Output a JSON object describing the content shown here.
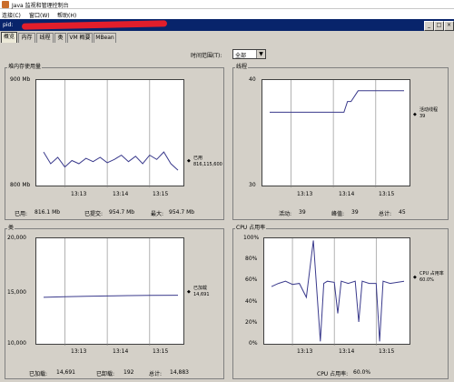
{
  "window": {
    "title": "Java 监视和管理控制台"
  },
  "menu": [
    "连接(C)",
    "窗口(W)",
    "帮助(H)"
  ],
  "pid_label": "pid:",
  "window_buttons": [
    "_",
    "□",
    "×"
  ],
  "tabs": [
    {
      "label": "概览",
      "active": true
    },
    {
      "label": "内存"
    },
    {
      "label": "线程"
    },
    {
      "label": "类"
    },
    {
      "label": "VM 概要"
    },
    {
      "label": "MBean"
    }
  ],
  "time_range": {
    "label": "时间范围(T):",
    "value": "全部",
    "arrow": "▼"
  },
  "colors": {
    "line": "#3a3a8c",
    "grid": "#808080"
  },
  "panels": {
    "heap": {
      "title": "堆内存使用量",
      "y_top": "900 Mb",
      "y_bottom": "800 Mb",
      "x_ticks": [
        "13:13",
        "13:14",
        "13:15"
      ],
      "legend_name": "已用",
      "legend_value": "816,115,600",
      "stats": [
        {
          "label": "已用:",
          "value": "816.1 Mb"
        },
        {
          "label": "已提交:",
          "value": "954.7 Mb"
        },
        {
          "label": "最大:",
          "value": "954.7 Mb"
        }
      ]
    },
    "threads": {
      "title": "线程",
      "y_top": "40",
      "y_bottom": "30",
      "x_ticks": [
        "13:13",
        "13:14",
        "13:15"
      ],
      "legend_name": "活动线程",
      "legend_value": "39",
      "stats": [
        {
          "label": "活动:",
          "value": "39"
        },
        {
          "label": "峰值:",
          "value": "39"
        },
        {
          "label": "总计:",
          "value": "45"
        }
      ]
    },
    "classes": {
      "title": "类",
      "y_top": "20,000",
      "y_mid": "15,000",
      "y_bottom": "10,000",
      "x_ticks": [
        "13:13",
        "13:14",
        "13:15"
      ],
      "legend_name": "已加载",
      "legend_value": "14,691",
      "stats": [
        {
          "label": "已加载:",
          "value": "14,691"
        },
        {
          "label": "已卸载:",
          "value": "192"
        },
        {
          "label": "总计:",
          "value": "14,883"
        }
      ]
    },
    "cpu": {
      "title": "CPU 占用率",
      "y_ticks": [
        "100%",
        "80%",
        "60%",
        "40%",
        "20%",
        "0%"
      ],
      "x_ticks": [
        "13:13",
        "13:14",
        "13:15"
      ],
      "legend_name": "CPU 占用率",
      "legend_value": "60.0%",
      "stats": [
        {
          "label": "CPU 占用率:",
          "value": "60.0%"
        }
      ]
    }
  },
  "chart_data": [
    {
      "type": "line",
      "title": "堆内存使用量",
      "ylabel": "Mb",
      "ylim": [
        800,
        900
      ],
      "x": [
        "13:12:30",
        "13:12:40",
        "13:12:50",
        "13:13:00",
        "13:13:10",
        "13:13:20",
        "13:13:30",
        "13:13:40",
        "13:13:50",
        "13:14:00",
        "13:14:10",
        "13:14:20",
        "13:14:30",
        "13:14:40",
        "13:14:50",
        "13:15:00",
        "13:15:10",
        "13:15:20",
        "13:15:30",
        "13:15:40"
      ],
      "series": [
        {
          "name": "已用",
          "values": [
            833,
            822,
            828,
            819,
            825,
            822,
            827,
            824,
            828,
            823,
            826,
            830,
            824,
            829,
            822,
            830,
            826,
            833,
            822,
            816
          ]
        }
      ]
    },
    {
      "type": "line",
      "title": "线程",
      "ylim": [
        30,
        40
      ],
      "x": [
        "13:12:30",
        "13:13:00",
        "13:13:30",
        "13:14:00",
        "13:14:15",
        "13:14:20",
        "13:14:25",
        "13:14:35",
        "13:15:00",
        "13:15:40"
      ],
      "series": [
        {
          "name": "活动线程",
          "values": [
            37,
            37,
            37,
            37,
            37,
            38,
            38,
            39,
            39,
            39
          ]
        }
      ]
    },
    {
      "type": "line",
      "title": "类",
      "ylim": [
        10000,
        20000
      ],
      "x": [
        "13:12:30",
        "13:13:00",
        "13:13:30",
        "13:14:00",
        "13:14:30",
        "13:15:00",
        "13:15:40"
      ],
      "series": [
        {
          "name": "已加载",
          "values": [
            14500,
            14550,
            14600,
            14630,
            14660,
            14680,
            14691
          ]
        }
      ]
    },
    {
      "type": "line",
      "title": "CPU 占用率",
      "ylabel": "%",
      "ylim": [
        0,
        100
      ],
      "x": [
        "13:12:30",
        "13:12:40",
        "13:12:50",
        "13:13:00",
        "13:13:10",
        "13:13:20",
        "13:13:30",
        "13:13:40",
        "13:13:45",
        "13:13:50",
        "13:14:00",
        "13:14:05",
        "13:14:10",
        "13:14:20",
        "13:14:30",
        "13:14:35",
        "13:14:40",
        "13:14:50",
        "13:15:00",
        "13:15:05",
        "13:15:10",
        "13:15:20",
        "13:15:40"
      ],
      "series": [
        {
          "name": "CPU 占用率",
          "values": [
            55,
            58,
            60,
            57,
            58,
            45,
            98,
            4,
            58,
            60,
            59,
            30,
            60,
            58,
            60,
            22,
            60,
            58,
            58,
            4,
            60,
            58,
            60
          ]
        }
      ]
    }
  ]
}
